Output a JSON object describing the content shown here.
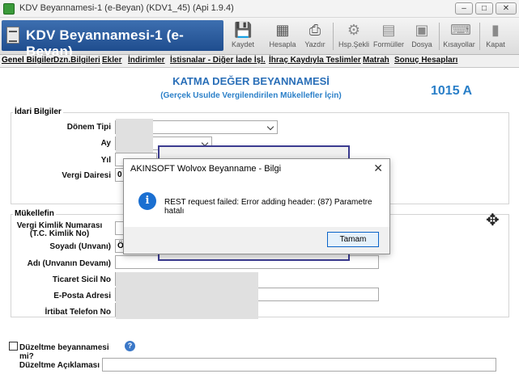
{
  "window": {
    "title": "KDV Beyannamesi-1 (e-Beyan) (KDV1_45) (Api 1.9.4)",
    "minimize_glyph": "–",
    "maximize_glyph": "□",
    "close_glyph": "✕"
  },
  "header": {
    "document_title": "KDV Beyannamesi-1 (e-Beyan)",
    "toolbar": [
      {
        "label": "Kaydet",
        "icon": "save-icon",
        "glyph": "💾"
      },
      {
        "label": "Hesapla",
        "icon": "calculator-icon",
        "glyph": "▦"
      },
      {
        "label": "Yazdır",
        "icon": "printer-icon",
        "glyph": "⎙"
      },
      {
        "label": "Hsp.Şekli",
        "icon": "gears-icon",
        "glyph": "⚙"
      },
      {
        "label": "Formüller",
        "icon": "formulas-icon",
        "glyph": "▤"
      },
      {
        "label": "Dosya",
        "icon": "file-icon",
        "glyph": "▣"
      },
      {
        "label": "Kısayollar",
        "icon": "shortcuts-icon",
        "glyph": "⌨"
      },
      {
        "label": "Kapat",
        "icon": "exit-door-icon",
        "glyph": "▮"
      }
    ]
  },
  "tabs": [
    "Genel Bilgiler",
    "Dzn.Bilgileri",
    "Ekler",
    "İndirimler",
    "İstisnalar - Diğer İade İşl.",
    "İhraç Kaydıyla Teslimler",
    "Matrah",
    "Sonuç Hesapları"
  ],
  "form": {
    "heading": "KATMA DEĞER BEYANNAMESİ",
    "subheading": "(Gerçek Usulde Vergilendirilen Mükellefler İçin)",
    "form_code": "1015 A",
    "idari": {
      "title": "İdari Bilgiler",
      "donem_tipi_label": "Dönem Tipi",
      "ay_label": "Ay",
      "yil_label": "Yıl",
      "vergi_dairesi_label": "Vergi Dairesi",
      "vergi_dairesi_value": "0"
    },
    "mukellef": {
      "title": "Mükellefin",
      "vkn_label": "Vergi Kimlik Numarası",
      "vkn_label2": "(T.C. Kimlik No)",
      "soyadi_label": "Soyadı (Unvanı)",
      "soyadi_value": "Ö",
      "adi_label": "Adı (Unvanın Devamı)",
      "ticaret_label": "Ticaret Sicil No",
      "eposta_label": "E-Posta Adresi",
      "irtibat_label": "İrtibat Telefon No"
    },
    "duzeltme_question": "Düzeltme beyannamesi mi?",
    "duzeltme_aciklama_label": "Düzeltme Açıklaması"
  },
  "dialog": {
    "title": "AKINSOFT Wolvox Beyanname - Bilgi",
    "message": "REST request failed: Error adding header: (87) Parametre hatalı",
    "ok_label": "Tamam",
    "close_glyph": "✕",
    "info_glyph": "i"
  }
}
